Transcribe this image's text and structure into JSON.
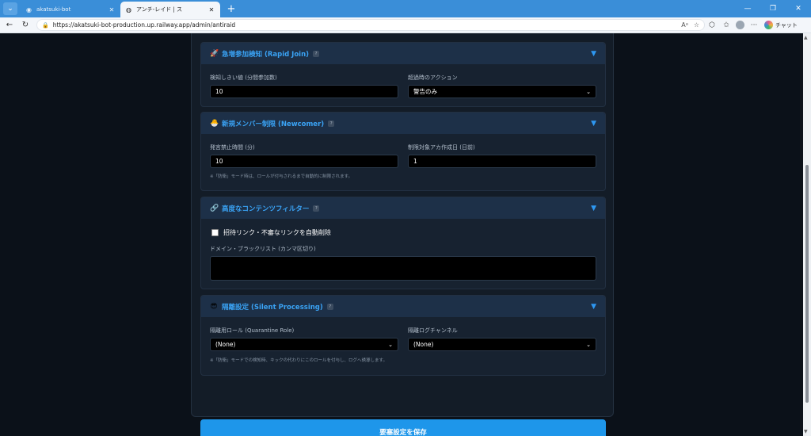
{
  "browser": {
    "tabs": [
      {
        "title": "akatsuki-bot",
        "favicon": "discord-favicon-icon",
        "active": false
      },
      {
        "title": "アンチ-レイド | ス",
        "favicon": "globe-icon",
        "active": true
      }
    ],
    "url": "https://akatsuki-bot-production.up.railway.app/admin/antiraid",
    "chat_label": "チャット"
  },
  "sections": {
    "rapid_join": {
      "icon": "🚀",
      "title": "急増参加検知 (Rapid Join)",
      "help": "?",
      "threshold_label": "検知しきい値 (分間参加数)",
      "threshold_value": "10",
      "action_label": "超過時のアクション",
      "action_value": "警告のみ"
    },
    "newcomer": {
      "icon": "🐣",
      "title": "新規メンバー制限 (Newcomer)",
      "help": "?",
      "mute_label": "発言禁止時間 (分)",
      "mute_value": "10",
      "age_label": "制限対象アカ作成日 (日前)",
      "age_value": "1",
      "note": "※「防衛」モード時は、ロールが付与されるまで自動的に制限されます。"
    },
    "content_filter": {
      "icon": "🔗",
      "title": "高度なコンテンツフィルター",
      "help": "?",
      "checkbox_label": "招待リンク・不審なリンクを自動削除",
      "checkbox_checked": false,
      "blacklist_label": "ドメイン・ブラックリスト (カンマ区切り)",
      "blacklist_value": ""
    },
    "silent": {
      "icon": "😎",
      "title": "隔離設定 (Silent Processing)",
      "help": "?",
      "role_label": "隔離用ロール (Quarantine Role)",
      "role_value": "(None)",
      "channel_label": "隔離ログチャンネル",
      "channel_value": "(None)",
      "note": "※「防衛」モードでの検知時、キックの代わりにこのロールを付与し、ログへ誘導します。"
    }
  },
  "save_button": "要塞設定を保存",
  "colors": {
    "accent": "#3aa3f5",
    "button": "#1e96ea",
    "page_bg": "#0b1119",
    "tab_bar": "#3a8ed8"
  }
}
